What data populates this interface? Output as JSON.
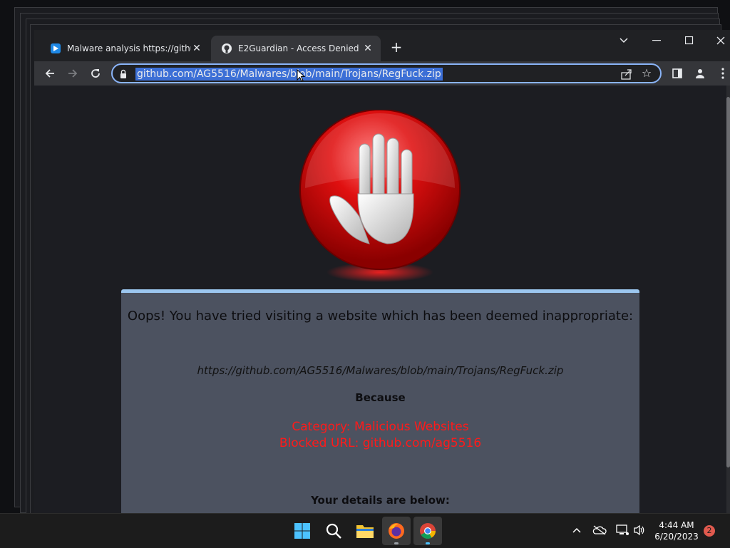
{
  "browser": {
    "tabs": [
      {
        "title": "Malware analysis https://github.c",
        "active": false
      },
      {
        "title": "E2Guardian - Access Denied",
        "active": true
      }
    ],
    "new_tab_label": "+",
    "address_bar": {
      "url": "github.com/AG5516/Malwares/blob/main/Trojans/RegFuck.zip"
    }
  },
  "page": {
    "heading": "Oops! You have tried visiting a website which has been deemed inappropriate:",
    "blocked_url": "https://github.com/AG5516/Malwares/blob/main/Trojans/RegFuck.zip",
    "because_label": "Because",
    "reason_category": "Category: Malicious Websites",
    "reason_blocked_url": "Blocked URL: github.com/ag5516",
    "details_label": "Your details are below:"
  },
  "taskbar": {
    "time": "4:44 AM",
    "date": "6/20/2023",
    "notification_count": "2"
  },
  "colors": {
    "accent": "#8ab4f8",
    "panel_bg": "#4c5260",
    "panel_top": "#9cc7f0",
    "warning_red": "#ff1a1a"
  },
  "icons": [
    "windows-start-icon",
    "search-icon",
    "file-explorer-icon",
    "firefox-icon",
    "chrome-icon",
    "stop-hand-icon",
    "lock-icon",
    "github-icon"
  ]
}
